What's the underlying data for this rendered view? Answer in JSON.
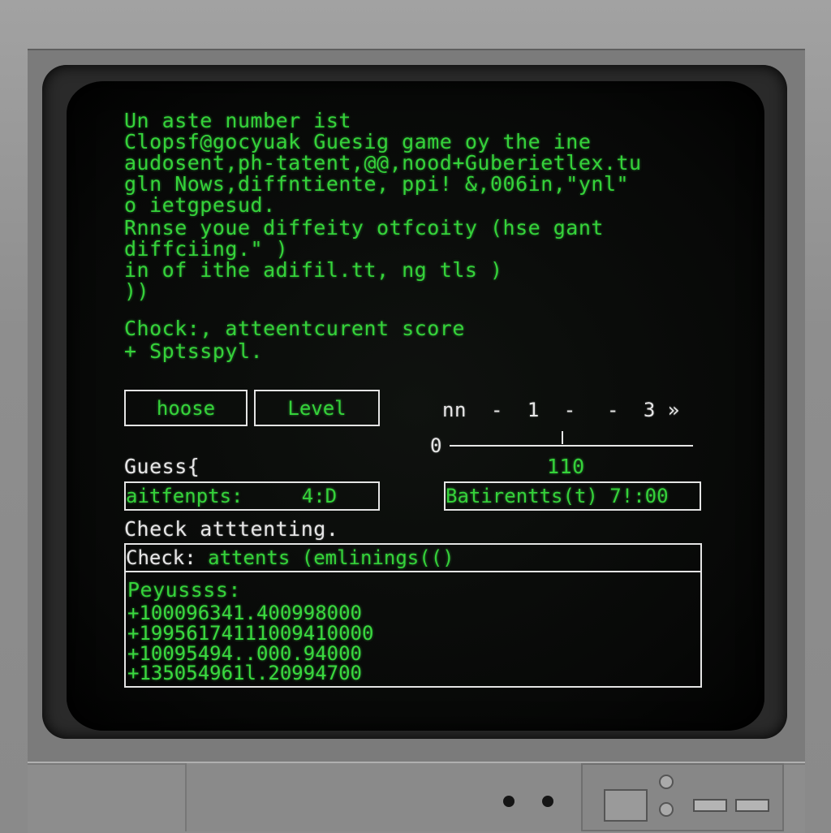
{
  "intro": {
    "lines": [
      "Un aste number ist",
      "Clopsf@gocyuak Guesig game oy the ine",
      "audosent,ph-tatent,@@,nood+Guberietlex.tu",
      "gln Nows,diffntiente, ppi! &,006in,\"ynl\"",
      "o ietgpesud."
    ]
  },
  "prompt": {
    "lines": [
      "Rnnse youe diffeity otfcoity (hse gant",
      "diffciing.\" )",
      "in of ithe adifil.tt, ng tls )",
      "))"
    ]
  },
  "check_section": {
    "lines": [
      "Chock:, atteentcurent score",
      "+ Sptsspyl."
    ]
  },
  "buttons": {
    "choose_label": "hoose",
    "level_label": "Level"
  },
  "slider": {
    "label_left": "nn",
    "label_mid": "-  1  -",
    "label_right": "-  3 »",
    "min_label": "0",
    "value_label": "110",
    "fraction": 0.46
  },
  "guess": {
    "label": "Guess{",
    "input_value": "aitfenpts:     4:D",
    "right_field_value": "Batirentts(t) 7!:00"
  },
  "status": {
    "line": "Check atttenting.",
    "bar_prefix": "Check:",
    "bar_text": " attents (emlinings(()"
  },
  "log": {
    "header": "Peyussss:",
    "rows": [
      "+100096341.400998000",
      "+19956174111009410000",
      "+10095494..000.94000",
      "+135054961l.20994700"
    ]
  },
  "colors": {
    "phosphor_green": "#35d23a",
    "frame_white": "#e4e4e4",
    "casing_gray": "#8a8a8a"
  }
}
